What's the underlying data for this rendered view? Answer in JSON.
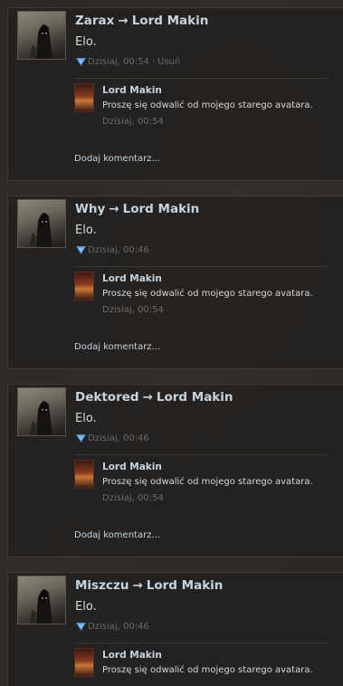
{
  "posts": [
    {
      "author": "Zarax",
      "arrow": "→",
      "recipient": "Lord Makin",
      "text": "Elo.",
      "time": "Dzisiaj, 00:54",
      "separator": "·",
      "delete_label": "Usuń",
      "comment": {
        "author": "Lord Makin",
        "text": "Proszę się odwalić od mojego starego avatara.",
        "time": "Dzisiaj, 00:54"
      },
      "add_comment_label": "Dodaj komentarz..."
    },
    {
      "author": "Why",
      "arrow": "→",
      "recipient": "Lord Makin",
      "text": "Elo.",
      "time": "Dzisiaj, 00:46",
      "comment": {
        "author": "Lord Makin",
        "text": "Proszę się odwalić od mojego starego avatara.",
        "time": "Dzisiaj, 00:54"
      },
      "add_comment_label": "Dodaj komentarz..."
    },
    {
      "author": "Dektored",
      "arrow": "→",
      "recipient": "Lord Makin",
      "text": "Elo.",
      "time": "Dzisiaj, 00:46",
      "comment": {
        "author": "Lord Makin",
        "text": "Proszę się odwalić od mojego starego avatara.",
        "time": "Dzisiaj, 00:54"
      },
      "add_comment_label": "Dodaj komentarz..."
    },
    {
      "author": "Miszczu",
      "arrow": "→",
      "recipient": "Lord Makin",
      "text": "Elo.",
      "time": "Dzisiaj, 00:46",
      "comment": {
        "author": "Lord Makin",
        "text": "Proszę się odwalić od mojego starego avatara."
      }
    }
  ],
  "icons": {
    "vote": "vote-arrow-icon",
    "author_avatar": "hooded-figure-avatar",
    "commenter_avatar": "commenter-avatar"
  },
  "colors": {
    "name_link": "#c6d4df",
    "body_text": "#d8d8d8",
    "muted": "#6b6b6b",
    "vote_icon": "#4a90d9"
  }
}
